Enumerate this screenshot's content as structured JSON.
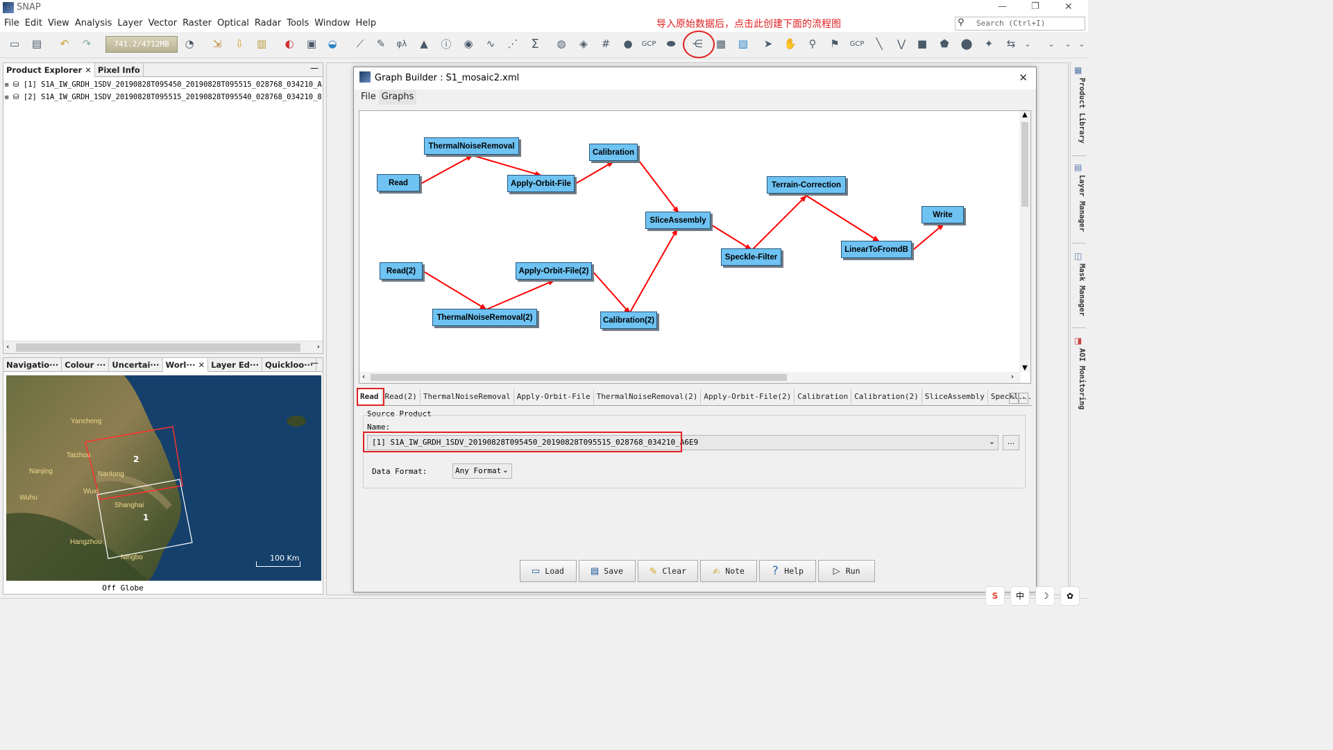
{
  "app": {
    "title": "SNAP"
  },
  "window_controls": {
    "minimize": "—",
    "restore": "❐",
    "close": "✕"
  },
  "menu": [
    "File",
    "Edit",
    "View",
    "Analysis",
    "Layer",
    "Vector",
    "Raster",
    "Optical",
    "Radar",
    "Tools",
    "Window",
    "Help"
  ],
  "search": {
    "placeholder": "Search (Ctrl+I)"
  },
  "annotation": {
    "text": "导入原始数据后，点击此创建下面的流程图",
    "color": "#e02020"
  },
  "memory": {
    "label": "741.2/4712MB"
  },
  "product_explorer": {
    "tabs": [
      "Product Explorer",
      "Pixel Info"
    ],
    "products": [
      "[1]  S1A_IW_GRDH_1SDV_20190828T095450_20190828T095515_028768_034210_A",
      "[2]  S1A_IW_GRDH_1SDV_20190828T095515_20190828T095540_028768_034210_8"
    ]
  },
  "bottom_tabs": [
    "Navigatio···",
    "Colour ···",
    "Uncertai···",
    "Worl···",
    "Layer Ed···",
    "Quickloo···"
  ],
  "world_view": {
    "status": "Off Globe",
    "scale": "100 Km",
    "cities": [
      "Yancheng",
      "Taizhou",
      "Nanjing",
      "Nantong",
      "Wuxi",
      "Wuhu",
      "Shanghai",
      "Hangzhou",
      "Ningbo"
    ],
    "footprints": [
      "1",
      "2"
    ]
  },
  "graph_builder": {
    "title": "Graph Builder : S1_mosaic2.xml",
    "menu": [
      "File",
      "Graphs"
    ],
    "nodes": [
      "Read",
      "ThermalNoiseRemoval",
      "Apply-Orbit-File",
      "Calibration",
      "SliceAssembly",
      "Terrain-Correction",
      "Write",
      "Speckle-Filter",
      "LinearToFromdB",
      "Read(2)",
      "Apply-Orbit-File(2)",
      "ThermalNoiseRemoval(2)",
      "Calibration(2)"
    ],
    "tabs": [
      "Read",
      "Read(2)",
      "ThermalNoiseRemoval",
      "Apply-Orbit-File",
      "ThermalNoiseRemoval(2)",
      "Apply-Orbit-File(2)",
      "Calibration",
      "Calibration(2)",
      "SliceAssembly",
      "Speckl..."
    ],
    "source_product": {
      "group_label": "Source Product",
      "name_label": "Name:",
      "name_value": "[1] S1A_IW_GRDH_1SDV_20190828T095450_20190828T095515_028768_034210_A6E9",
      "browse": "...",
      "format_label": "Data Format:",
      "format_value": "Any Format"
    },
    "buttons": [
      "Load",
      "Save",
      "Clear",
      "Note",
      "Help",
      "Run"
    ]
  },
  "right_sidebar": [
    "Product Library",
    "Layer Manager",
    "Mask Manager",
    "AOI Monitoring"
  ],
  "tray": [
    "S",
    "中",
    "☽",
    "✿"
  ]
}
